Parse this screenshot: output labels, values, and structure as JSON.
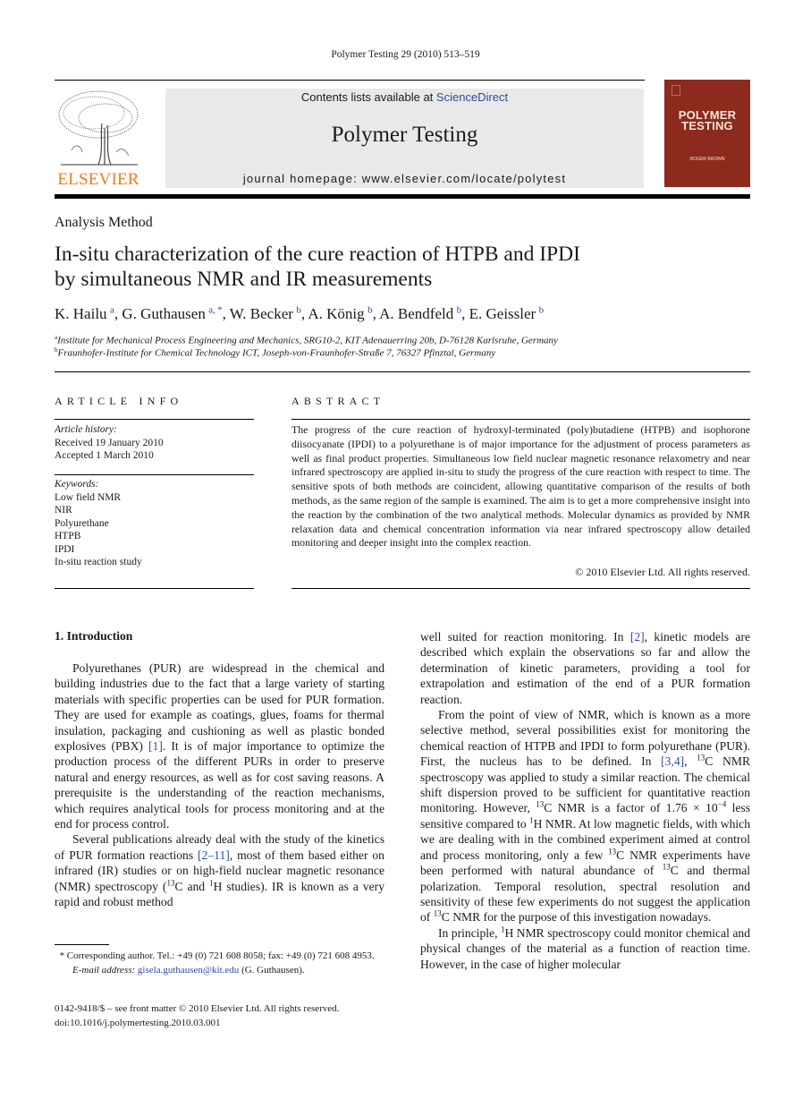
{
  "journal_ref": "Polymer Testing 29 (2010) 513–519",
  "header": {
    "publisher_logo": "elsevier-tree-logo",
    "publisher_name": "ELSEVIER",
    "contents_prefix": "Contents lists available at ",
    "contents_link": "ScienceDirect",
    "journal_name": "Polymer Testing",
    "homepage_label": "journal homepage: ",
    "homepage_url": "www.elsevier.com/locate/polytest",
    "cover": {
      "title_line1": "POLYMER",
      "title_line2": "TESTING",
      "editor": "ROGER BROWN",
      "color": "#8c2a1e"
    },
    "colors": {
      "link": "#2f4aa0",
      "elsevier_orange": "#f07b20",
      "header_bg": "#e9e9e9"
    }
  },
  "article": {
    "type": "Analysis Method",
    "title_line1": "In-situ characterization of the cure reaction of HTPB and IPDI",
    "title_line2": "by simultaneous NMR and IR measurements",
    "authors": [
      {
        "name": "K. Hailu",
        "sup": "a",
        "sep": ", "
      },
      {
        "name": "G. Guthausen",
        "sup": "a, *",
        "sep": ", "
      },
      {
        "name": "W. Becker",
        "sup": "b",
        "sep": ", "
      },
      {
        "name": "A. König",
        "sup": "b",
        "sep": ", "
      },
      {
        "name": "A. Bendfeld",
        "sup": "b",
        "sep": ", "
      },
      {
        "name": "E. Geissler",
        "sup": "b",
        "sep": ""
      }
    ],
    "affiliations": [
      {
        "key": "a",
        "text": "Institute for Mechanical Process Engineering and Mechanics, SRG10-2, KIT Adenauerring 20b, D-76128 Karlsruhe, Germany"
      },
      {
        "key": "b",
        "text": "Fraunhofer-Institute for Chemical Technology ICT, Joseph-von-Fraunhofer-Straße 7, 76327 Pfinztal, Germany"
      }
    ]
  },
  "article_info": {
    "heading": "ARTICLE INFO",
    "history_label": "Article history:",
    "received": "Received 19 January 2010",
    "accepted": "Accepted 1 March 2010",
    "keywords_label": "Keywords:",
    "keywords": [
      "Low field NMR",
      "NIR",
      "Polyurethane",
      "HTPB",
      "IPDI",
      "In-situ reaction study"
    ]
  },
  "abstract": {
    "heading": "ABSTRACT",
    "text": "The progress of the cure reaction of hydroxyl-terminated (poly)butadiene (HTPB) and isophorone diisocyanate (IPDI) to a polyurethane is of major importance for the adjustment of process parameters as well as final product properties. Simultaneous low field nuclear magnetic resonance relaxometry and near infrared spectroscopy are applied in-situ to study the progress of the cure reaction with respect to time. The sensitive spots of both methods are coincident, allowing quantitative comparison of the results of both methods, as the same region of the sample is examined. The aim is to get a more comprehensive insight into the reaction by the combination of the two analytical methods. Molecular dynamics as provided by NMR relaxation data and chemical concentration information via near infrared spectroscopy allow detailed monitoring and deeper insight into the complex reaction.",
    "copyright": "© 2010 Elsevier Ltd. All rights reserved."
  },
  "body": {
    "section_heading": "1.  Introduction",
    "left": {
      "p1_a": "Polyurethanes (PUR) are widespread in the chemical and building industries due to the fact that a large variety of starting materials with specific properties can be used for PUR formation. They are used for example as coatings, glues, foams for thermal insulation, packaging and cushioning as well as plastic bonded explosives (PBX) ",
      "p1_ref": "[1]",
      "p1_b": ". It is of major importance to optimize the production process of the different PURs in order to preserve natural and energy resources, as well as for cost saving reasons. A prerequisite is the understanding of the reaction mechanisms, which requires analytical tools for process monitoring and at the end for process control.",
      "p2_a": "Several publications already deal with the study of the kinetics of PUR formation reactions ",
      "p2_ref": "[2–11]",
      "p2_b": ", most of them based either on infrared (IR) studies or on high-field nuclear magnetic resonance (NMR) spectroscopy (",
      "p2_sup1": "13",
      "p2_c": "C and ",
      "p2_sup2": "1",
      "p2_d": "H studies). IR is known as a very rapid and robust method"
    },
    "right": {
      "p1_a": "well suited for reaction monitoring. In ",
      "p1_ref": "[2]",
      "p1_b": ", kinetic models are described which explain the observations so far and allow the determination of kinetic parameters, providing a tool for extrapolation and estimation of the end of a PUR formation reaction.",
      "p2_a": "From the point of view of NMR, which is known as a more selective method, several possibilities exist for monitoring the chemical reaction of HTPB and IPDI to form polyurethane (PUR). First, the nucleus has to be defined. In ",
      "p2_ref": "[3,4]",
      "p2_b": ", ",
      "p2_sup1": "13",
      "p2_c": "C NMR spectroscopy was applied to study a similar reaction. The chemical shift dispersion proved to be sufficient for quantitative reaction monitoring. However, ",
      "p2_sup2": "13",
      "p2_d": "C NMR is a factor of 1.76 × 10",
      "p2_sup3": "−4",
      "p2_e": " less sensitive compared to ",
      "p2_sup4": "1",
      "p2_f": "H NMR. At low magnetic fields, with which we are dealing with in the combined experiment aimed at control and process monitoring, only a few ",
      "p2_sup5": "13",
      "p2_g": "C NMR experiments have been performed with natural abundance of ",
      "p2_sup6": "13",
      "p2_h": "C and thermal polarization. Temporal resolution, spectral resolution and sensitivity of these few experiments do not suggest the application of ",
      "p2_sup7": "13",
      "p2_i": "C NMR for the purpose of this investigation nowadays.",
      "p3_a": "In principle, ",
      "p3_sup1": "1",
      "p3_b": "H NMR spectroscopy could monitor chemical and physical changes of the material as a function of reaction time. However, in the case of higher molecular"
    }
  },
  "footnote": {
    "star": "*",
    "corresponding": " Corresponding author. Tel.: +49 (0) 721 608 8058; fax: +49 (0) 721 608 4953.",
    "email_label": "E-mail address: ",
    "email": "gisela.guthausen@kit.edu",
    "email_suffix": " (G. Guthausen)."
  },
  "front_matter": {
    "issn_line": "0142-9418/$ – see front matter © 2010 Elsevier Ltd. All rights reserved.",
    "doi": "doi:10.1016/j.polymertesting.2010.03.001"
  }
}
